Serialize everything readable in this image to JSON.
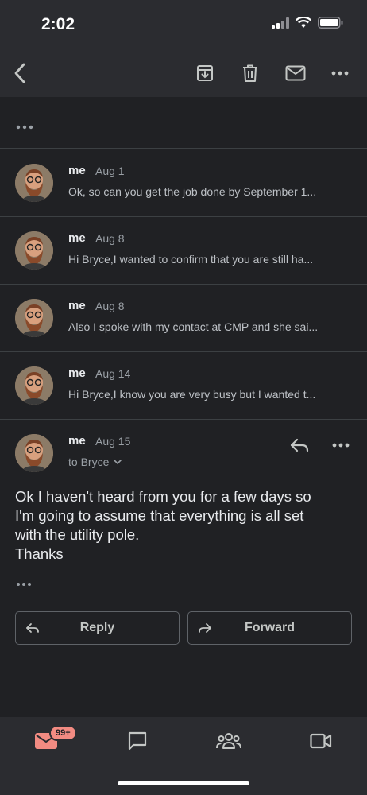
{
  "status_bar": {
    "time": "2:02"
  },
  "toolbar": {
    "back_icon": "back-arrow-icon",
    "archive_icon": "archive-icon",
    "delete_icon": "trash-icon",
    "mark_unread_icon": "mail-icon",
    "more_icon": "more-horizontal-icon"
  },
  "thread": {
    "collapsed_indicator": "•••",
    "messages": [
      {
        "sender": "me",
        "date": "Aug 1",
        "snippet": "Ok, so can you get the job done by September 1..."
      },
      {
        "sender": "me",
        "date": "Aug 8",
        "snippet": "Hi Bryce,I wanted to confirm that you are still ha..."
      },
      {
        "sender": "me",
        "date": "Aug 8",
        "snippet": "Also I spoke with my contact at CMP and she sai..."
      },
      {
        "sender": "me",
        "date": "Aug 14",
        "snippet": "Hi Bryce,I know you are very busy but I wanted t..."
      }
    ],
    "open_message": {
      "sender": "me",
      "date": "Aug 15",
      "recipient": "to Bryce",
      "body_lines": [
        "Ok I haven't heard from you for a few days so",
        "I'm going to assume that everything is all set",
        "with the utility pole.",
        "Thanks"
      ],
      "trimmed_indicator": "•••"
    }
  },
  "actions": {
    "reply_label": "Reply",
    "forward_label": "Forward"
  },
  "bottom_nav": {
    "mail_badge": "99+"
  },
  "colors": {
    "background": "#202124",
    "bar": "#2b2c30",
    "badge": "#f28b82",
    "mail_active": "#f28b82"
  }
}
